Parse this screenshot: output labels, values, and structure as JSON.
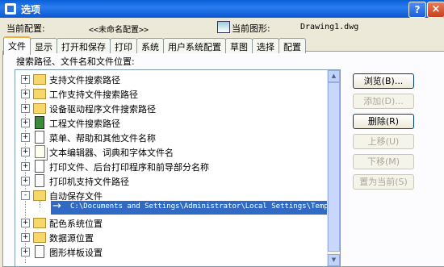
{
  "window": {
    "title": "选项",
    "help_label": "?",
    "close_label": "×"
  },
  "profile": {
    "current_config_label": "当前配置:",
    "current_config_value": "<<未命名配置>>",
    "current_drawing_label": "当前图形:",
    "current_drawing_value": "Drawing1.dwg"
  },
  "tabs": [
    {
      "label": "文件",
      "active": true
    },
    {
      "label": "显示"
    },
    {
      "label": "打开和保存"
    },
    {
      "label": "打印"
    },
    {
      "label": "系统"
    },
    {
      "label": "用户系统配置"
    },
    {
      "label": "草图"
    },
    {
      "label": "选择"
    },
    {
      "label": "配置"
    }
  ],
  "panel": {
    "label": "搜索路径、文件名和文件位置:"
  },
  "tree": {
    "items": [
      {
        "label": "支持文件搜索路径",
        "icon": "folder-icon",
        "expander": "+"
      },
      {
        "label": "工作支持文件搜索路径",
        "icon": "folder-icon",
        "expander": "+"
      },
      {
        "label": "设备驱动程序文件搜索路径",
        "icon": "folder-icon",
        "expander": "+"
      },
      {
        "label": "工程文件搜索路径",
        "icon": "project-icon",
        "expander": "+"
      },
      {
        "label": "菜单、帮助和其他文件名称",
        "icon": "document-icon",
        "expander": "+"
      },
      {
        "label": "文本编辑器、词典和字体文件名",
        "icon": "document-icon",
        "expander": "+"
      },
      {
        "label": "打印文件、后台打印程序和前导部分名称",
        "icon": "document-icon",
        "expander": "+"
      },
      {
        "label": "打印机支持文件路径",
        "icon": "document-icon",
        "expander": "+"
      },
      {
        "label": "自动保存文件",
        "icon": "folder-icon",
        "expander": "-"
      },
      {
        "label": "配色系统位置",
        "icon": "folder-icon",
        "expander": "+"
      },
      {
        "label": "数据源位置",
        "icon": "folder-icon",
        "expander": "+"
      },
      {
        "label": "图形样板设置",
        "icon": "document-icon",
        "expander": "+"
      }
    ],
    "selected_path": "C:\\Documents and Settings\\Administrator\\Local Settings\\Temp\\"
  },
  "buttons": {
    "browse": "浏览(B)...",
    "add": "添加(D)...",
    "remove": "删除(R)",
    "move_up": "上移(U)",
    "move_down": "下移(M)",
    "set_current": "置为当前(S)"
  }
}
